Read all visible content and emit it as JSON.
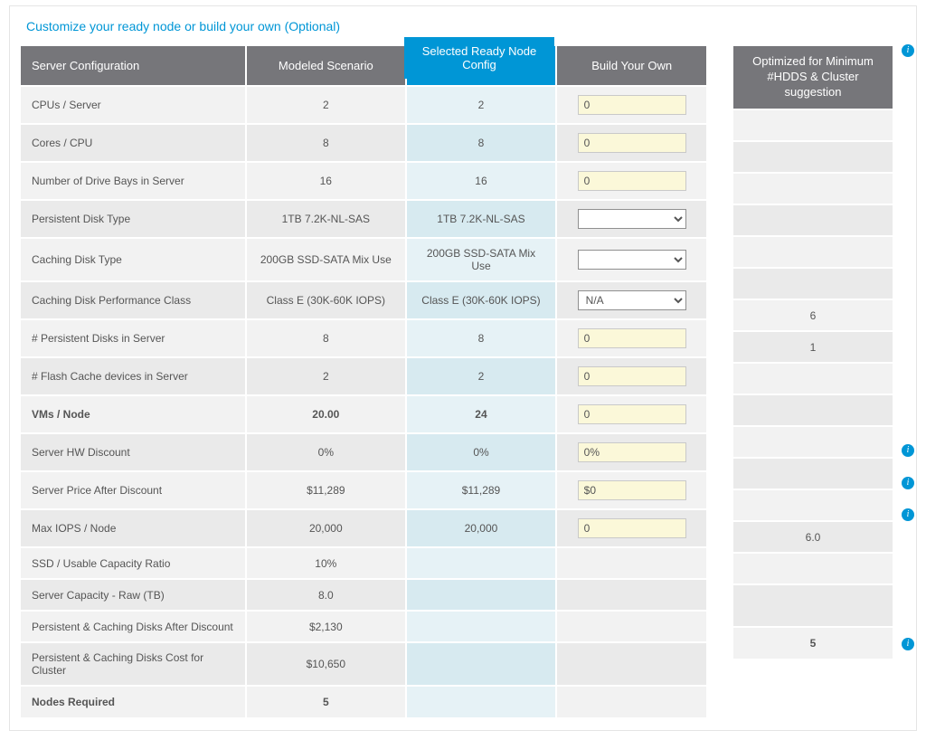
{
  "title": "Customize your ready node or build your own (Optional)",
  "headers": {
    "server_config": "Server Configuration",
    "modeled": "Modeled Scenario",
    "selected": "Selected Ready Node Config",
    "byo": "Build Your Own",
    "optimized": "Optimized for Minimum #HDDS & Cluster suggestion"
  },
  "rows": [
    {
      "key": "cpus",
      "label": "CPUs / Server",
      "modeled": "2",
      "selected": "2",
      "byo_type": "text",
      "byo": "0",
      "opt": ""
    },
    {
      "key": "cores",
      "label": "Cores / CPU",
      "modeled": "8",
      "selected": "8",
      "byo_type": "text",
      "byo": "0",
      "opt": ""
    },
    {
      "key": "bays",
      "label": "Number of Drive Bays in Server",
      "modeled": "16",
      "selected": "16",
      "byo_type": "text",
      "byo": "0",
      "opt": ""
    },
    {
      "key": "pdisk_type",
      "label": "Persistent Disk Type",
      "modeled": "1TB 7.2K-NL-SAS",
      "selected": "1TB 7.2K-NL-SAS",
      "byo_type": "select",
      "byo": "",
      "opt": ""
    },
    {
      "key": "cdisk_type",
      "label": "Caching Disk Type",
      "modeled": "200GB SSD-SATA Mix Use",
      "selected": "200GB SSD-SATA Mix Use",
      "byo_type": "select",
      "byo": "",
      "opt": ""
    },
    {
      "key": "cdisk_perf",
      "label": "Caching Disk Performance Class",
      "modeled": "Class E (30K-60K IOPS)",
      "selected": "Class E (30K-60K IOPS)",
      "byo_type": "select",
      "byo": "N/A",
      "opt": ""
    },
    {
      "key": "npdisks",
      "label": "# Persistent Disks in Server",
      "modeled": "8",
      "selected": "8",
      "byo_type": "text",
      "byo": "0",
      "opt": "6"
    },
    {
      "key": "nflash",
      "label": "# Flash Cache devices in Server",
      "modeled": "2",
      "selected": "2",
      "byo_type": "text",
      "byo": "0",
      "opt": "1"
    },
    {
      "key": "vms",
      "label": "VMs / Node",
      "modeled": "20.00",
      "selected": "24",
      "byo_type": "text",
      "byo": "0",
      "opt": "",
      "bold": true
    },
    {
      "key": "hwdisc",
      "label": "Server HW Discount",
      "modeled": "0%",
      "selected": "0%",
      "byo_type": "text",
      "byo": "0%",
      "opt": ""
    },
    {
      "key": "spad",
      "label": "Server Price After Discount",
      "modeled": "$11,289",
      "selected": "$11,289",
      "byo_type": "text",
      "byo": "$0",
      "opt": ""
    },
    {
      "key": "maxiops",
      "label": "Max IOPS / Node",
      "modeled": "20,000",
      "selected": "20,000",
      "byo_type": "text",
      "byo": "0",
      "opt": ""
    },
    {
      "key": "ssdratio",
      "label": "SSD / Usable Capacity Ratio",
      "modeled": "10%",
      "selected": "",
      "byo_type": "none",
      "byo": "",
      "opt": ""
    },
    {
      "key": "rawcap",
      "label": "Server Capacity - Raw (TB)",
      "modeled": "8.0",
      "selected": "",
      "byo_type": "none",
      "byo": "",
      "opt": "6.0"
    },
    {
      "key": "pcdad",
      "label": "Persistent & Caching Disks After Discount",
      "modeled": "$2,130",
      "selected": "",
      "byo_type": "none",
      "byo": "",
      "opt": ""
    },
    {
      "key": "pcdcluster",
      "label": "Persistent & Caching Disks Cost for Cluster",
      "modeled": "$10,650",
      "selected": "",
      "byo_type": "none",
      "byo": "",
      "opt": ""
    },
    {
      "key": "nodes",
      "label": "Nodes Required",
      "modeled": "5",
      "selected": "",
      "byo_type": "none",
      "byo": "",
      "opt": "5",
      "bold": true
    }
  ]
}
